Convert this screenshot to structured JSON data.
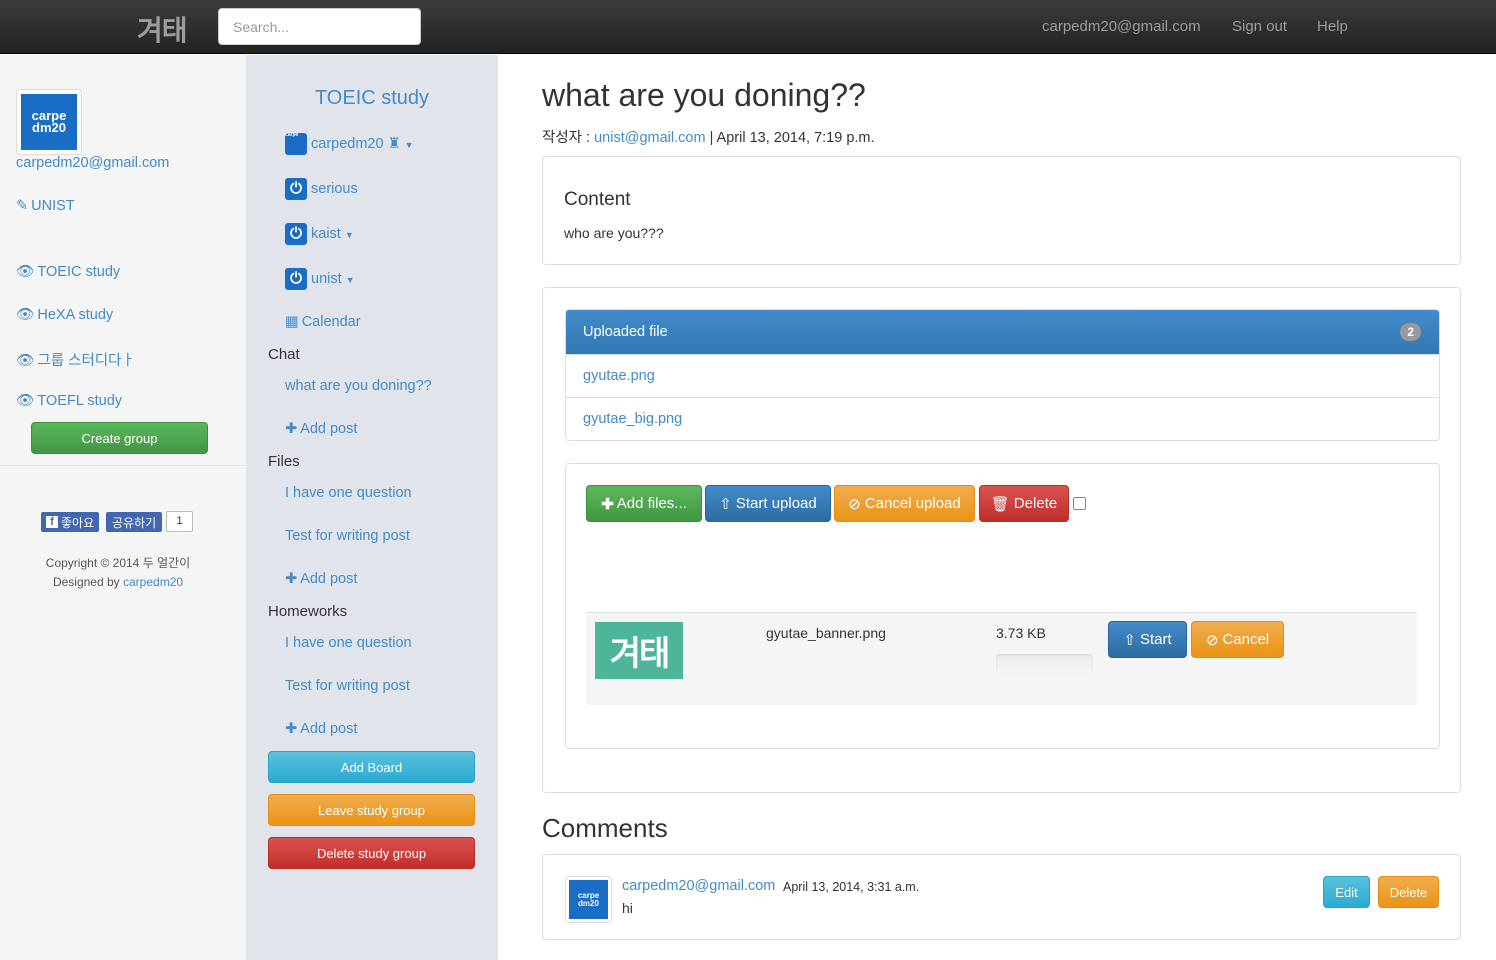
{
  "navbar": {
    "brand": "겨태",
    "search_placeholder": "Search...",
    "user_email": "carpedm20@gmail.com",
    "signout": "Sign out",
    "help": "Help"
  },
  "left": {
    "avatar_text": [
      "carpe",
      "dm20"
    ],
    "email": "carpedm20@gmail.com",
    "school": "UNIST",
    "groups": [
      "TOEIC study",
      "HeXA study",
      "그룹 스터디다ㅏ",
      "TOEFL study"
    ],
    "create_group": "Create group",
    "fb_like": "좋아요",
    "fb_share": "공유하기",
    "fb_count": "1",
    "copyright": "Copyright © 2014 두 얼간이",
    "designed_by": "Designed by",
    "designer": "carpedm20"
  },
  "middle": {
    "group_title": "TOEIC study",
    "members": [
      {
        "name": "carpedm20",
        "crown": "♜",
        "dropdown": true
      },
      {
        "name": "serious",
        "dropdown": false
      },
      {
        "name": "kaist",
        "dropdown": true
      },
      {
        "name": "unist",
        "dropdown": true
      }
    ],
    "calendar": "Calendar",
    "boards": [
      {
        "title": "Chat",
        "posts": [
          "what are you doning??"
        ],
        "add": "Add post"
      },
      {
        "title": "Files",
        "posts": [
          "I have one question",
          "Test for writing post"
        ],
        "add": "Add post"
      },
      {
        "title": "Homeworks",
        "posts": [
          "I have one question",
          "Test for writing post"
        ],
        "add": "Add post"
      }
    ],
    "add_board": "Add Board",
    "leave_group": "Leave study group",
    "delete_group": "Delete study group"
  },
  "post": {
    "title": "what are you doning??",
    "author_label": "작성자 :",
    "author": "unist@gmail.com",
    "date": "| April 13, 2014, 7:19 p.m.",
    "content_heading": "Content",
    "content_body": "who are you???"
  },
  "uploaded": {
    "heading": "Uploaded file",
    "count": "2",
    "files": [
      "gyutae.png",
      "gyutae_big.png"
    ]
  },
  "uploader": {
    "add_files": "Add files...",
    "start_upload": "Start upload",
    "cancel_upload": "Cancel upload",
    "delete": "Delete",
    "queue": [
      {
        "thumb_text": "겨태",
        "name": "gyutae_banner.png",
        "size": "3.73 KB",
        "progress": 0,
        "start": "Start",
        "cancel": "Cancel"
      }
    ]
  },
  "comments": {
    "heading": "Comments",
    "items": [
      {
        "author": "carpedm20@gmail.com",
        "date": "April 13, 2014, 3:31 a.m.",
        "text": "hi",
        "edit": "Edit",
        "delete": "Delete"
      }
    ]
  },
  "colors": {
    "primary": "#428bca",
    "success": "#5cb85c",
    "warning": "#f0ad4e",
    "danger": "#d9534f",
    "info": "#5bc0de",
    "navbar": "#222222"
  }
}
